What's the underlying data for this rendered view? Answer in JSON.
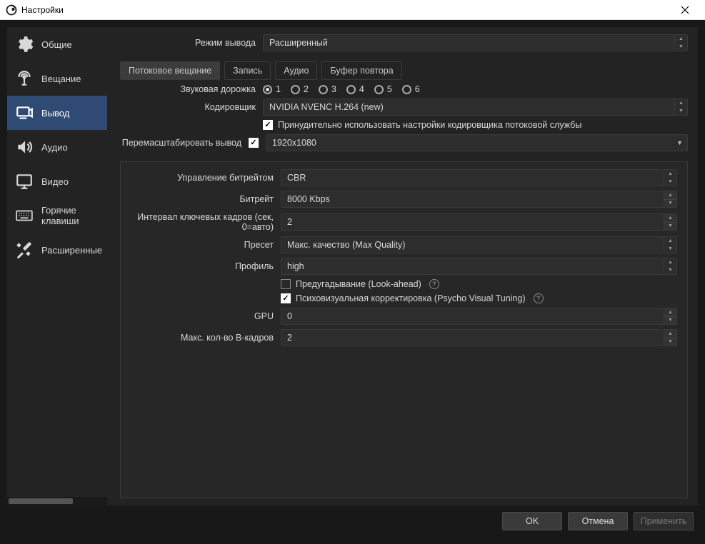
{
  "titlebar": {
    "title": "Настройки"
  },
  "sidebar": {
    "items": [
      {
        "label": "Общие"
      },
      {
        "label": "Вещание"
      },
      {
        "label": "Вывод"
      },
      {
        "label": "Аудио"
      },
      {
        "label": "Видео"
      },
      {
        "label": "Горячие клавиши"
      },
      {
        "label": "Расширенные"
      }
    ]
  },
  "main": {
    "output_mode": {
      "label": "Режим вывода",
      "value": "Расширенный"
    },
    "tabs": [
      {
        "label": "Потоковое вещание"
      },
      {
        "label": "Запись"
      },
      {
        "label": "Аудио"
      },
      {
        "label": "Буфер повтора"
      }
    ],
    "audio_track": {
      "label": "Звуковая дорожка",
      "options": [
        "1",
        "2",
        "3",
        "4",
        "5",
        "6"
      ],
      "selected": "1"
    },
    "encoder": {
      "label": "Кодировщик",
      "value": "NVIDIA NVENC H.264 (new)"
    },
    "enforce_checkbox": {
      "label": "Принудительно использовать настройки кодировщика потоковой службы",
      "checked": true
    },
    "rescale": {
      "label": "Перемасштабировать вывод",
      "checked": true,
      "value": "1920x1080"
    },
    "rate_control": {
      "label": "Управление битрейтом",
      "value": "CBR"
    },
    "bitrate": {
      "label": "Битрейт",
      "value": "8000 Kbps"
    },
    "keyframe": {
      "label": "Интервал ключевых кадров (сек, 0=авто)",
      "value": "2"
    },
    "preset": {
      "label": "Пресет",
      "value": "Макс. качество (Max Quality)"
    },
    "profile": {
      "label": "Профиль",
      "value": "high"
    },
    "lookahead": {
      "label": "Предугадывание (Look-ahead)",
      "checked": false
    },
    "psycho": {
      "label": "Психовизуальная корректировка (Psycho Visual Tuning)",
      "checked": true
    },
    "gpu": {
      "label": "GPU",
      "value": "0"
    },
    "bframes": {
      "label": "Макс. кол-во B-кадров",
      "value": "2"
    }
  },
  "footer": {
    "ok": "OK",
    "cancel": "Отмена",
    "apply": "Применить"
  }
}
